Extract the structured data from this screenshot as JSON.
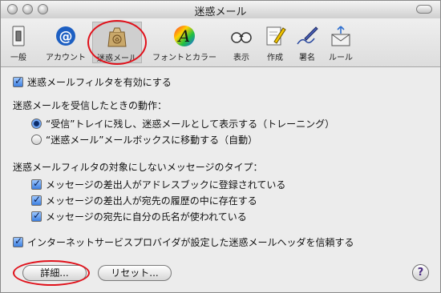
{
  "window": {
    "title": "迷惑メール"
  },
  "toolbar": {
    "items": [
      {
        "label": "一般"
      },
      {
        "label": "アカウント"
      },
      {
        "label": "迷惑メール"
      },
      {
        "label": "フォントとカラー"
      },
      {
        "label": "表示"
      },
      {
        "label": "作成"
      },
      {
        "label": "署名"
      },
      {
        "label": "ルール"
      }
    ],
    "font_icon_letter": "A",
    "accounts_icon_glyph": "@"
  },
  "junk": {
    "enable_filter": {
      "label": "迷惑メールフィルタを有効にする",
      "checked": true
    },
    "action_heading": "迷惑メールを受信したときの動作：",
    "action_options": [
      {
        "label": "“受信”トレイに残し、迷惑メールとして表示する（トレーニング）",
        "selected": true
      },
      {
        "label": "“迷惑メール”メールボックスに移動する（自動）",
        "selected": false
      }
    ],
    "exempt_heading": "迷惑メールフィルタの対象にしないメッセージのタイプ：",
    "exempt_options": [
      {
        "label": "メッセージの差出人がアドレスブックに登録されている",
        "checked": true
      },
      {
        "label": "メッセージの差出人が宛先の履歴の中に存在する",
        "checked": true
      },
      {
        "label": "メッセージの宛先に自分の氏名が使われている",
        "checked": true
      }
    ],
    "trust_headers": {
      "label": "インターネットサービスプロバイダが設定した迷惑メールヘッダを信頼する",
      "checked": true
    },
    "advanced_button": "詳細...",
    "reset_button": "リセット...",
    "help_button": "?"
  },
  "colors": {
    "annotation_red": "#e0101a",
    "help_purple": "#4b2b82"
  }
}
